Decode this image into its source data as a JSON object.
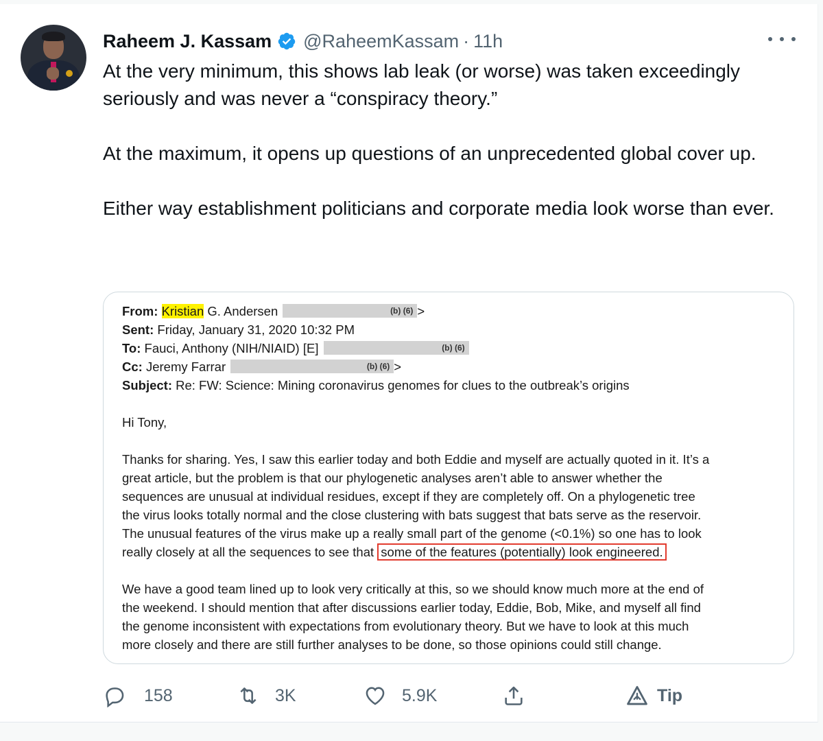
{
  "tweet": {
    "author_name": "Raheem J. Kassam",
    "handle": "@RaheemKassam",
    "separator": "·",
    "time": "11h",
    "paragraphs": [
      "At the very minimum, this shows lab leak (or worse) was taken exceedingly seriously and was never a “conspiracy theory.”",
      "At the maximum, it opens up questions of an unprecedented global cover up.",
      "Either way establishment politicians and corporate media look worse than ever."
    ]
  },
  "email": {
    "from_label": "From:",
    "from_first": "Kristian",
    "from_rest": " G. Andersen",
    "from_code": "(b) (6)",
    "from_tail": ">",
    "sent_label": "Sent:",
    "sent_value": " Friday, January 31, 2020 10:32 PM",
    "to_label": "To:",
    "to_value": " Fauci, Anthony (NIH/NIAID) [E]",
    "to_code": "(b) (6)",
    "cc_label": "Cc:",
    "cc_value": " Jeremy Farrar",
    "cc_code": "(b) (6)",
    "cc_tail": ">",
    "subject_label": "Subject:",
    "subject_value": " Re: FW: Science: Mining coronavirus genomes for clues to the outbreak’s origins",
    "greeting": "Hi Tony,",
    "p1_lines": [
      "Thanks for sharing. Yes, I saw this earlier today and both Eddie and myself are actually quoted in it. It’s a",
      "great article, but the problem is that our phylogenetic analyses aren’t able to answer whether the",
      "sequences are unusual at individual residues, except if they are completely off. On a phylogenetic tree",
      "the virus looks totally normal and the close clustering with bats suggest that bats serve as the reservoir.",
      "The unusual features of the virus make up a really small part of the genome (<0.1%) so one has to look"
    ],
    "p1_last_plain": "really closely at all the sequences to see that ",
    "p1_last_boxed": "some of the features (potentially) look engineered.",
    "p2_lines": [
      "We have a good team lined up to look very critically at this, so we should know much more at the end of",
      "the weekend. I should mention that after discussions earlier today, Eddie, Bob, Mike, and myself all find",
      "the genome inconsistent with expectations from evolutionary theory. But we have to look at this much",
      "more closely and there are still further analyses to be done, so those opinions could still change."
    ]
  },
  "actions": {
    "replies": "158",
    "retweets": "3K",
    "likes": "5.9K",
    "tip": "Tip"
  },
  "colors": {
    "verified": "#1d9bf0",
    "text": "#0f1419",
    "secondary": "#536471",
    "highlight": "#fff200",
    "box": "#e23b2e"
  }
}
